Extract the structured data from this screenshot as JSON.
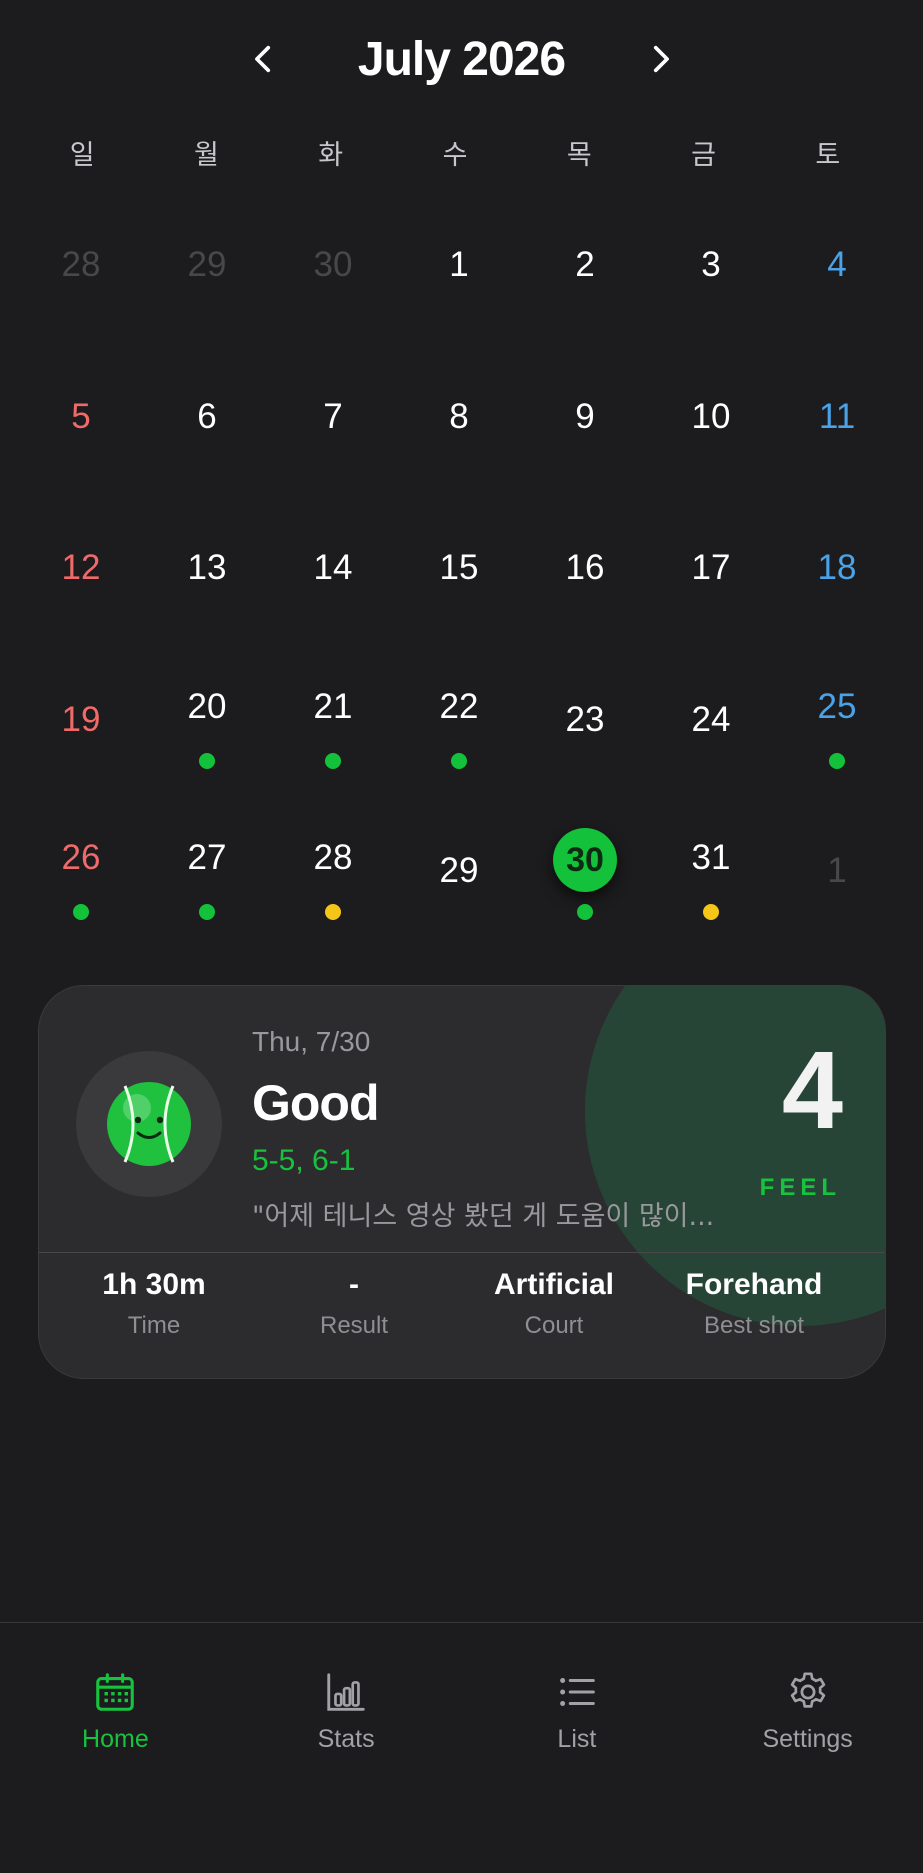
{
  "header": {
    "title": "July 2026",
    "prev_icon": "chevron-left-icon",
    "next_icon": "chevron-right-icon"
  },
  "weekdays": [
    "일",
    "월",
    "화",
    "수",
    "목",
    "금",
    "토"
  ],
  "colors": {
    "accent": "#13c23a",
    "sunday": "#f06a6a",
    "saturday": "#4aa3e8",
    "dot_green": "#13c23a",
    "dot_yellow": "#f5c518"
  },
  "calendar": {
    "days": [
      {
        "label": "28",
        "kind": "muted"
      },
      {
        "label": "29",
        "kind": "muted"
      },
      {
        "label": "30",
        "kind": "muted"
      },
      {
        "label": "1",
        "kind": "normal"
      },
      {
        "label": "2",
        "kind": "normal"
      },
      {
        "label": "3",
        "kind": "normal"
      },
      {
        "label": "4",
        "kind": "sat"
      },
      {
        "label": "5",
        "kind": "sun"
      },
      {
        "label": "6",
        "kind": "normal"
      },
      {
        "label": "7",
        "kind": "normal"
      },
      {
        "label": "8",
        "kind": "normal"
      },
      {
        "label": "9",
        "kind": "normal"
      },
      {
        "label": "10",
        "kind": "normal"
      },
      {
        "label": "11",
        "kind": "sat"
      },
      {
        "label": "12",
        "kind": "sun"
      },
      {
        "label": "13",
        "kind": "normal"
      },
      {
        "label": "14",
        "kind": "normal"
      },
      {
        "label": "15",
        "kind": "normal"
      },
      {
        "label": "16",
        "kind": "normal"
      },
      {
        "label": "17",
        "kind": "normal"
      },
      {
        "label": "18",
        "kind": "sat"
      },
      {
        "label": "19",
        "kind": "sun"
      },
      {
        "label": "20",
        "kind": "normal",
        "dot": "green"
      },
      {
        "label": "21",
        "kind": "normal",
        "dot": "green"
      },
      {
        "label": "22",
        "kind": "normal",
        "dot": "green"
      },
      {
        "label": "23",
        "kind": "normal"
      },
      {
        "label": "24",
        "kind": "normal"
      },
      {
        "label": "25",
        "kind": "sat",
        "dot": "green"
      },
      {
        "label": "26",
        "kind": "sun",
        "dot": "green"
      },
      {
        "label": "27",
        "kind": "normal",
        "dot": "green"
      },
      {
        "label": "28",
        "kind": "normal",
        "dot": "yellow"
      },
      {
        "label": "29",
        "kind": "normal"
      },
      {
        "label": "30",
        "kind": "today",
        "dot": "green"
      },
      {
        "label": "31",
        "kind": "normal",
        "dot": "yellow"
      },
      {
        "label": "1",
        "kind": "muted"
      }
    ]
  },
  "card": {
    "avatar_icon": "tennis-ball-smile-icon",
    "date": "Thu, 7/30",
    "mood": "Good",
    "score": "5-5, 6-1",
    "note": "\"어제 테니스 영상 봤던 게 도움이 많이...",
    "feel_value": "4",
    "feel_label": "FEEL",
    "stats": [
      {
        "value": "1h 30m",
        "label": "Time"
      },
      {
        "value": "-",
        "label": "Result"
      },
      {
        "value": "Artificial",
        "label": "Court"
      },
      {
        "value": "Forehand",
        "label": "Best shot"
      }
    ]
  },
  "tabbar": {
    "items": [
      {
        "label": "Home",
        "icon": "calendar-icon",
        "active": true
      },
      {
        "label": "Stats",
        "icon": "bar-chart-icon",
        "active": false
      },
      {
        "label": "List",
        "icon": "list-icon",
        "active": false
      },
      {
        "label": "Settings",
        "icon": "gear-icon",
        "active": false
      }
    ]
  }
}
